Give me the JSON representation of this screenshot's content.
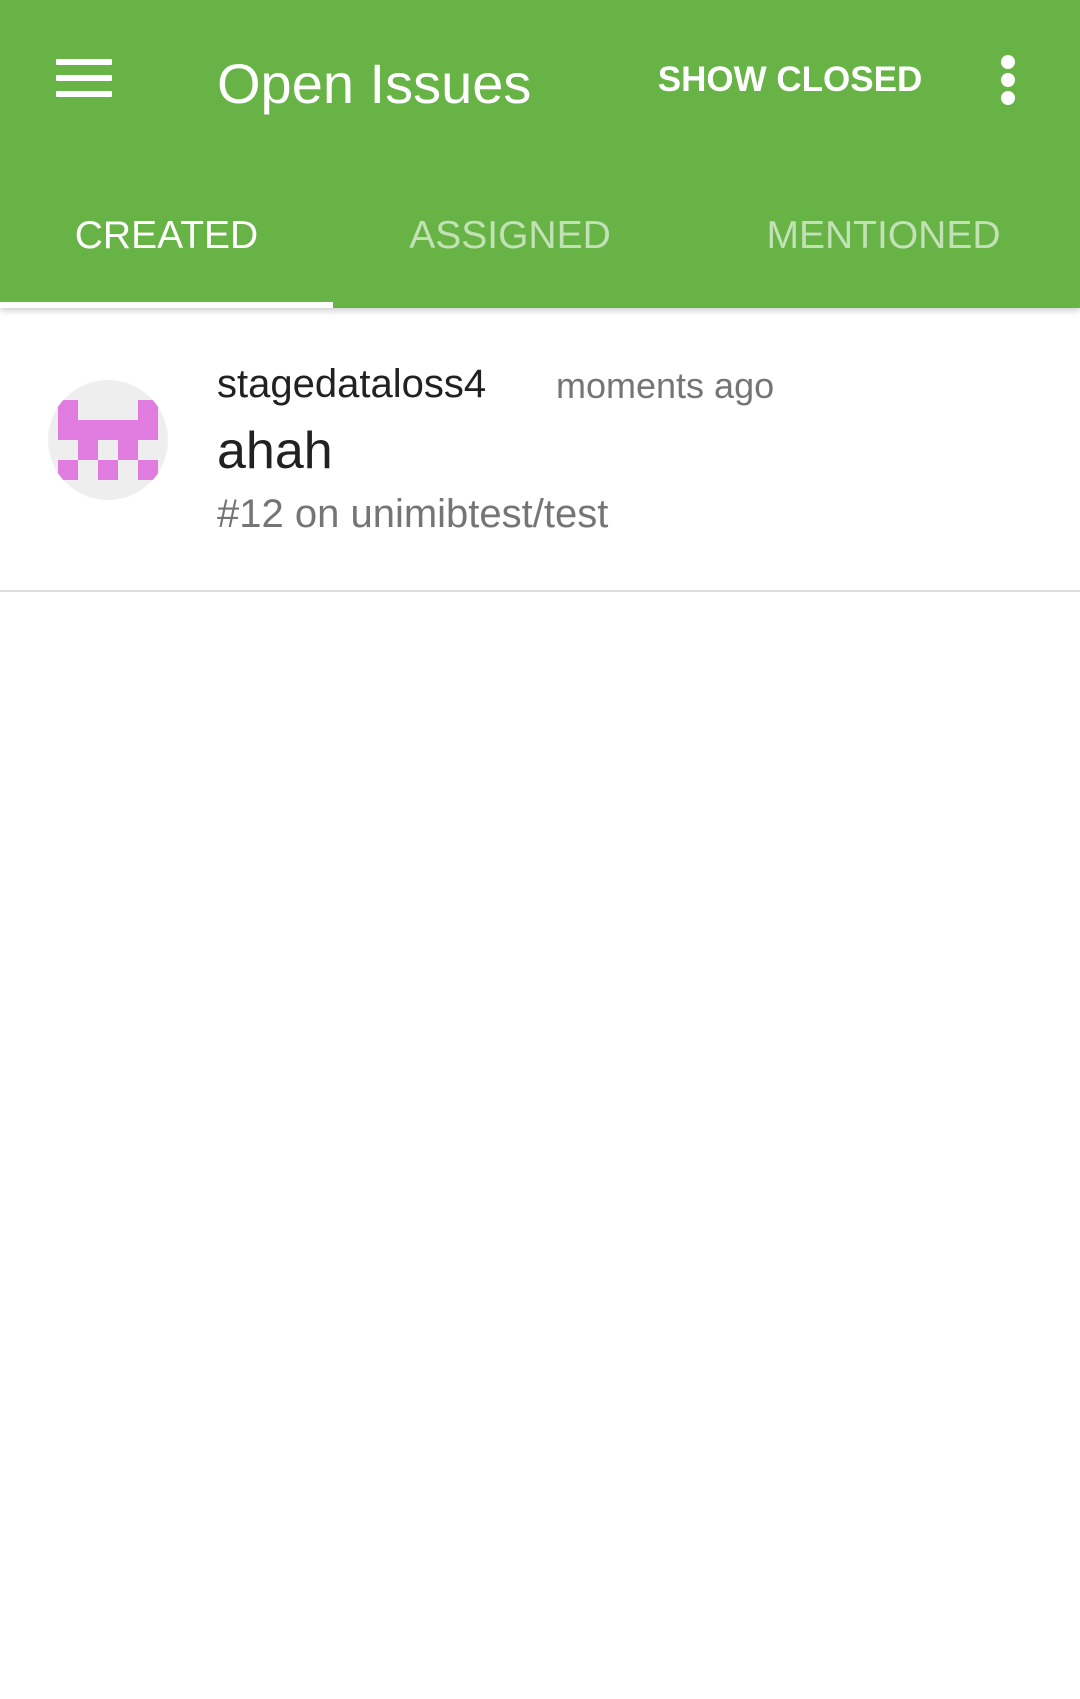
{
  "toolbar": {
    "title": "Open Issues",
    "action_label": "SHOW CLOSED",
    "menu_icon": "hamburger-menu-icon",
    "overflow_icon": "more-vertical-icon"
  },
  "tabs": [
    {
      "label": "CREATED",
      "selected": true
    },
    {
      "label": "ASSIGNED",
      "selected": false
    },
    {
      "label": "MENTIONED",
      "selected": false
    }
  ],
  "issues": [
    {
      "author": "stagedataloss4",
      "time": "moments ago",
      "title": "ahah",
      "meta": "#12 on unimibtest/test",
      "avatar_icon": "identicon-avatar"
    }
  ],
  "colors": {
    "primary": "#67b346",
    "tab_inactive": "rgba(255,255,255,0.6)",
    "identicon": "#e07bdf",
    "text_primary": "#212121",
    "text_secondary": "#757575"
  }
}
